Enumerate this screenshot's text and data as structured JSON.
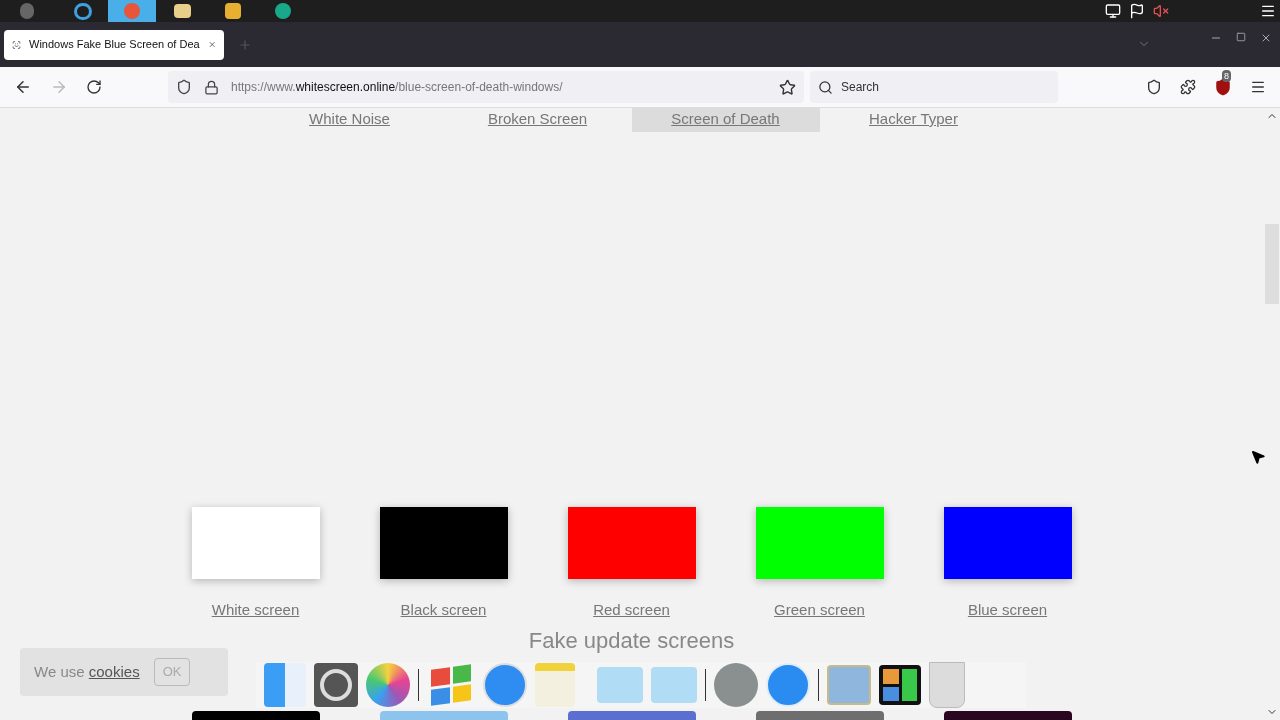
{
  "tab": {
    "title": "Windows Fake Blue Screen of Dea"
  },
  "address": {
    "prefix": "https://www.",
    "domain": "whitescreen.online",
    "path": "/blue-screen-of-death-windows/"
  },
  "search": {
    "placeholder": "Search"
  },
  "extension_badge": "8",
  "nav_links": [
    {
      "label": "White Noise",
      "selected": false
    },
    {
      "label": "Broken Screen",
      "selected": false
    },
    {
      "label": "Screen of Death",
      "selected": true
    },
    {
      "label": "Hacker Typer",
      "selected": false
    }
  ],
  "color_screens": [
    {
      "label": "White screen",
      "color": "#ffffff"
    },
    {
      "label": "Black screen",
      "color": "#000000"
    },
    {
      "label": "Red screen",
      "color": "#ff0000"
    },
    {
      "label": "Green screen",
      "color": "#00ff00"
    },
    {
      "label": "Blue screen",
      "color": "#0000ff"
    }
  ],
  "section_heading": "Fake update screens",
  "update_screens": [
    {
      "color": "#000000"
    },
    {
      "color": "#8cc4ee"
    },
    {
      "color": "#5b6fd0"
    },
    {
      "color": "#6e6e6e"
    },
    {
      "color": "#2a0620"
    }
  ],
  "cookie_banner": {
    "text": "We use",
    "link": "cookies",
    "button": "OK"
  }
}
